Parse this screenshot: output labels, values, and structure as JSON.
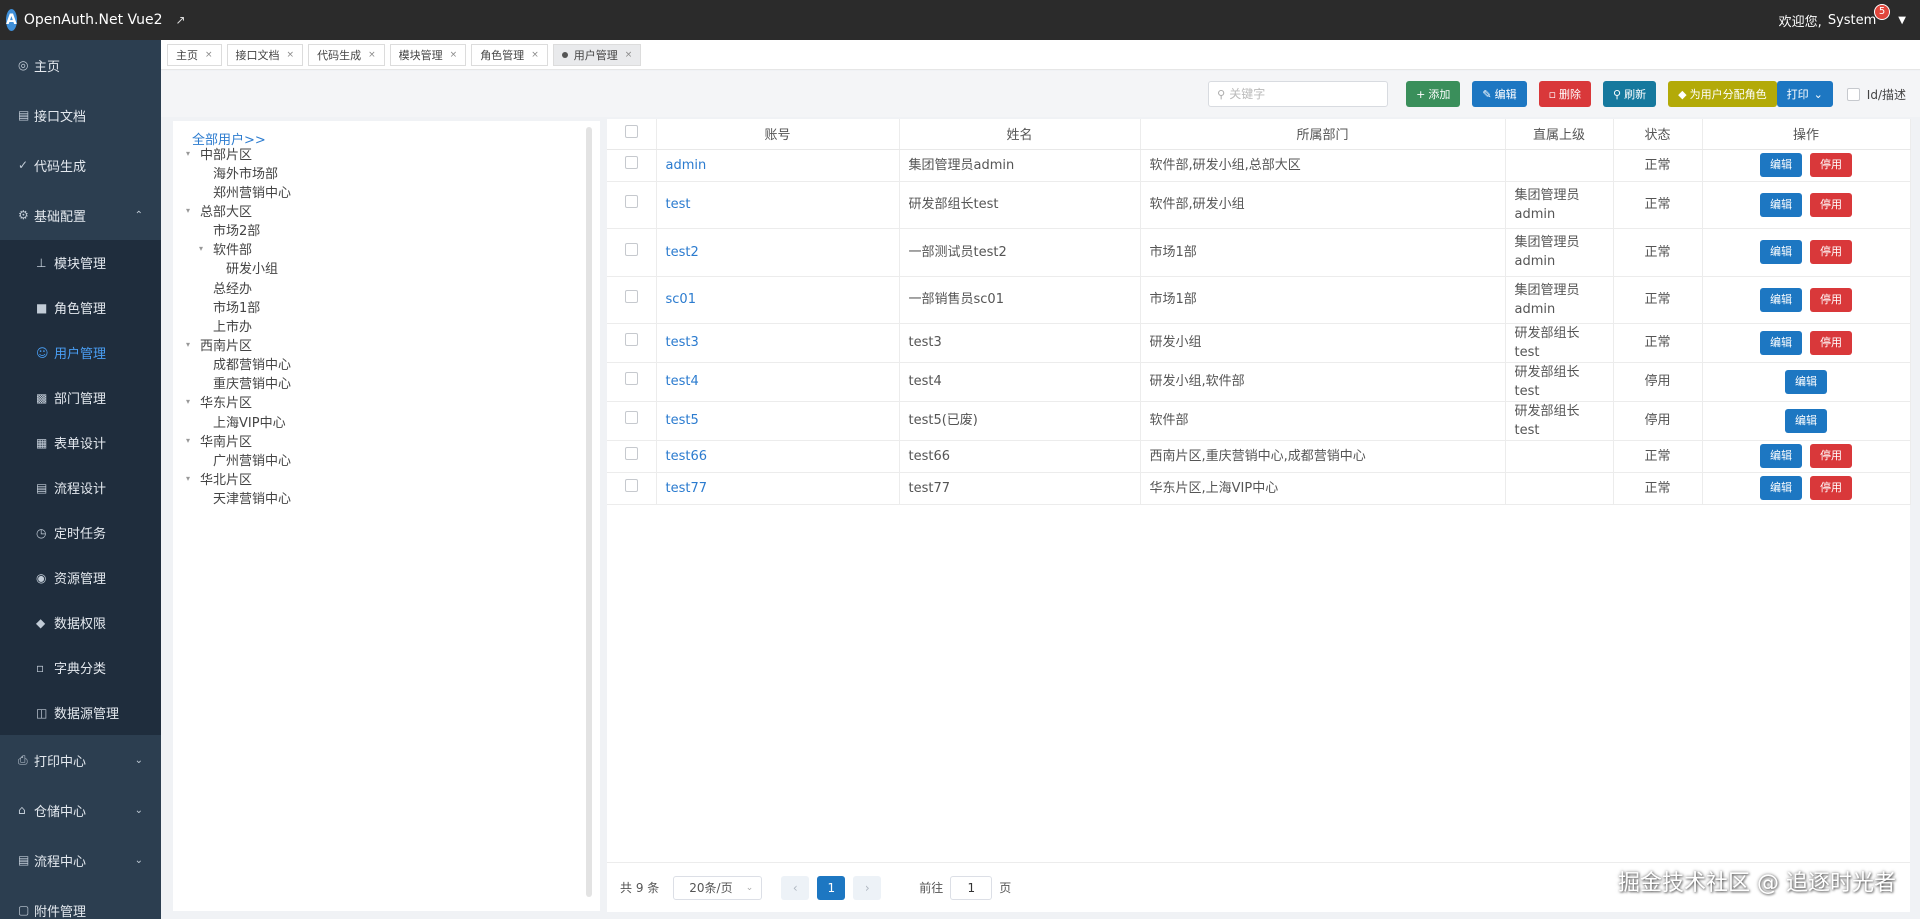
{
  "app": {
    "title": "OpenAuth.Net Vue2",
    "welcome": "欢迎您,",
    "user": "System",
    "notifications": "5"
  },
  "sidebar": {
    "items": [
      {
        "label": "主页",
        "icon": "dashboard-icon"
      },
      {
        "label": "接口文档",
        "icon": "api-icon"
      },
      {
        "label": "代码生成",
        "icon": "check-icon"
      },
      {
        "label": "基础配置",
        "icon": "settings-icon",
        "expanded": true
      },
      {
        "label": "打印中心",
        "icon": "printer-icon"
      },
      {
        "label": "仓储中心",
        "icon": "warehouse-icon"
      },
      {
        "label": "流程中心",
        "icon": "flow-icon"
      },
      {
        "label": "附件管理",
        "icon": "attachment-icon"
      }
    ],
    "sub_items": [
      {
        "label": "模块管理",
        "icon": "sitemap-icon"
      },
      {
        "label": "角色管理",
        "icon": "group-icon"
      },
      {
        "label": "用户管理",
        "icon": "user-icon",
        "active": true
      },
      {
        "label": "部门管理",
        "icon": "department-icon"
      },
      {
        "label": "表单设计",
        "icon": "form-icon"
      },
      {
        "label": "流程设计",
        "icon": "flow-design-icon"
      },
      {
        "label": "定时任务",
        "icon": "clock-icon"
      },
      {
        "label": "资源管理",
        "icon": "globe-icon"
      },
      {
        "label": "数据权限",
        "icon": "data-permission-icon"
      },
      {
        "label": "字典分类",
        "icon": "dictionary-icon"
      },
      {
        "label": "数据源管理",
        "icon": "database-icon"
      }
    ]
  },
  "tabs": [
    {
      "label": "主页"
    },
    {
      "label": "接口文档"
    },
    {
      "label": "代码生成"
    },
    {
      "label": "模块管理"
    },
    {
      "label": "角色管理"
    },
    {
      "label": "用户管理",
      "active": true
    }
  ],
  "toolbar": {
    "search_placeholder": "关键字",
    "add": "添加",
    "edit": "编辑",
    "delete": "删除",
    "refresh": "刷新",
    "assign_role": "为用户分配角色",
    "print": "打印",
    "id_desc": "Id/描述"
  },
  "tree": {
    "all_label": "全部用户>>",
    "nodes": [
      {
        "label": "中部片区",
        "level": 0,
        "expandable": true
      },
      {
        "label": "海外市场部",
        "level": 1
      },
      {
        "label": "郑州营销中心",
        "level": 1
      },
      {
        "label": "总部大区",
        "level": 0,
        "expandable": true
      },
      {
        "label": "市场2部",
        "level": 1
      },
      {
        "label": "软件部",
        "level": 1,
        "expandable": true
      },
      {
        "label": "研发小组",
        "level": 2
      },
      {
        "label": "总经办",
        "level": 1
      },
      {
        "label": "市场1部",
        "level": 1
      },
      {
        "label": "上市办",
        "level": 1
      },
      {
        "label": "西南片区",
        "level": 0,
        "expandable": true
      },
      {
        "label": "成都营销中心",
        "level": 1
      },
      {
        "label": "重庆营销中心",
        "level": 1
      },
      {
        "label": "华东片区",
        "level": 0,
        "expandable": true
      },
      {
        "label": "上海VIP中心",
        "level": 1
      },
      {
        "label": "华南片区",
        "level": 0,
        "expandable": true
      },
      {
        "label": "广州营销中心",
        "level": 1
      },
      {
        "label": "华北片区",
        "level": 0,
        "expandable": true
      },
      {
        "label": "天津营销中心",
        "level": 1
      }
    ]
  },
  "table": {
    "columns": [
      "账号",
      "姓名",
      "所属部门",
      "直属上级",
      "状态",
      "操作"
    ],
    "edit_label": "编辑",
    "disable_label": "停用",
    "rows": [
      {
        "account": "admin",
        "name": "集团管理员admin",
        "dept": "软件部,研发小组,总部大区",
        "superior": "",
        "status": "正常",
        "active": true
      },
      {
        "account": "test",
        "name": "研发部组长test",
        "dept": "软件部,研发小组",
        "superior": "集团管理员admin",
        "status": "正常",
        "active": true
      },
      {
        "account": "test2",
        "name": "一部测试员test2",
        "dept": "市场1部",
        "superior": "集团管理员admin",
        "status": "正常",
        "active": true
      },
      {
        "account": "sc01",
        "name": "一部销售员sc01",
        "dept": "市场1部",
        "superior": "集团管理员admin",
        "status": "正常",
        "active": true
      },
      {
        "account": "test3",
        "name": "test3",
        "dept": "研发小组",
        "superior": "研发部组长test",
        "status": "正常",
        "active": true
      },
      {
        "account": "test4",
        "name": "test4",
        "dept": "研发小组,软件部",
        "superior": "研发部组长test",
        "status": "停用",
        "active": false
      },
      {
        "account": "test5",
        "name": "test5(已废)",
        "dept": "软件部",
        "superior": "研发部组长test",
        "status": "停用",
        "active": false
      },
      {
        "account": "test66",
        "name": "test66",
        "dept": "西南片区,重庆营销中心,成都营销中心",
        "superior": "",
        "status": "正常",
        "active": true
      },
      {
        "account": "test77",
        "name": "test77",
        "dept": "华东片区,上海VIP中心",
        "superior": "",
        "status": "正常",
        "active": true
      }
    ]
  },
  "pager": {
    "total": "共 9 条",
    "page_size": "20条/页",
    "current_page": "1",
    "goto_label": "前往",
    "goto_value": "1",
    "page_suffix": "页"
  },
  "watermark": "掘金技术社区 @ 追逐时光者",
  "colors": {
    "topbar": "#2b2b2b",
    "sidebar": "#2c3e50",
    "submenu": "#1f2d3d",
    "primary": "#1d77c2",
    "danger": "#d9383a",
    "success": "#3a8f5b",
    "status_ok": "#5cb85c",
    "status_off": "#f08080"
  }
}
